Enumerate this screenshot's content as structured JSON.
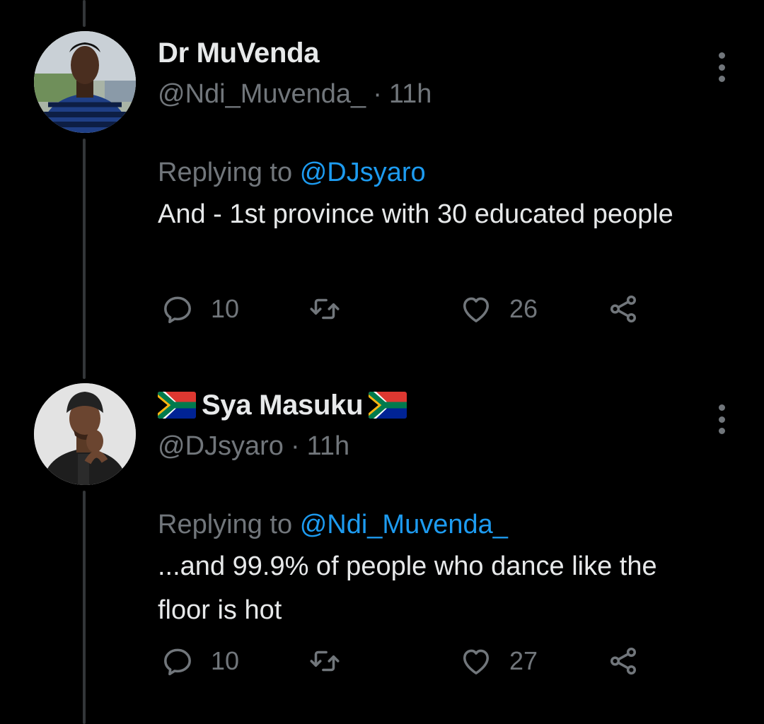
{
  "tweets": [
    {
      "display_name": "Dr MuVenda",
      "handle": "@Ndi_Muvenda_",
      "separator": "·",
      "time": "11h",
      "replying_prefix": "Replying to",
      "replying_to": "@DJsyaro",
      "text": "And - 1st province with 30 educated people",
      "reply_count": "10",
      "retweet_count": "",
      "like_count": "26",
      "avatar_icon": "profile-photo-man-striped-sweater"
    },
    {
      "display_name": "Sya Masuku",
      "name_flags": [
        "south-africa-flag",
        "south-africa-flag"
      ],
      "handle": "@DJsyaro",
      "separator": "·",
      "time": "11h",
      "replying_prefix": "Replying to",
      "replying_to": "@Ndi_Muvenda_",
      "text": "...and 99.9% of people who dance like the floor is hot",
      "reply_count": "10",
      "retweet_count": "",
      "like_count": "27",
      "avatar_icon": "profile-photo-man-beanie"
    }
  ],
  "colors": {
    "background": "#000000",
    "primary_text": "#e7e9ea",
    "secondary_text": "#71767b",
    "link": "#1d9bf0",
    "thread_line": "#333639"
  },
  "icons": [
    "reply-icon",
    "retweet-icon",
    "like-icon",
    "share-icon",
    "more-options-icon"
  ]
}
